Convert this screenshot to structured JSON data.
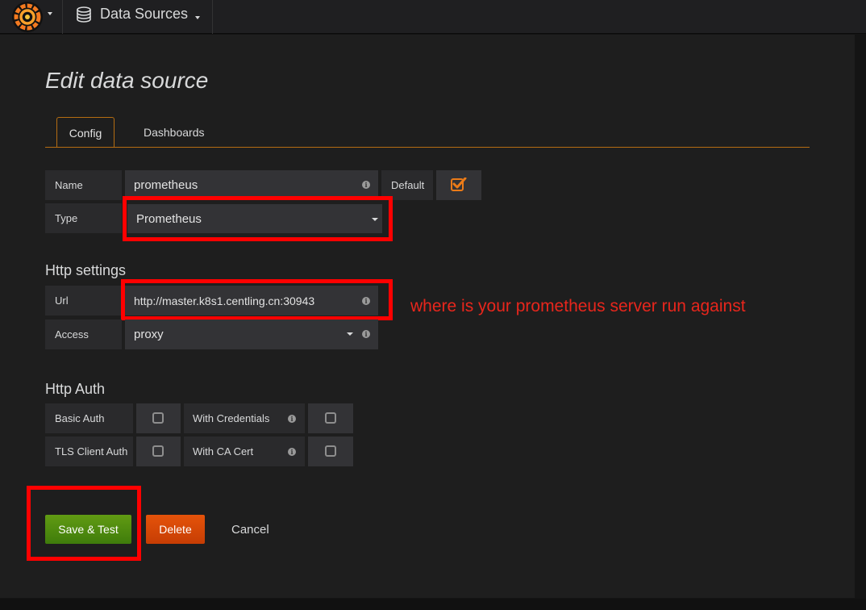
{
  "nav": {
    "breadcrumb_label": "Data Sources",
    "logo_icon": "grafana-logo-icon",
    "breadcrumb_icon": "database-icon"
  },
  "page": {
    "title": "Edit data source"
  },
  "tabs": [
    {
      "label": "Config",
      "active": true
    },
    {
      "label": "Dashboards",
      "active": false
    }
  ],
  "form": {
    "name_label": "Name",
    "name_value": "prometheus",
    "default_label": "Default",
    "default_checked": true,
    "type_label": "Type",
    "type_value": "Prometheus"
  },
  "http_settings": {
    "title": "Http settings",
    "url_label": "Url",
    "url_value": "http://master.k8s1.centling.cn:30943",
    "access_label": "Access",
    "access_value": "proxy"
  },
  "http_auth": {
    "title": "Http Auth",
    "basic_auth_label": "Basic Auth",
    "basic_auth_checked": false,
    "with_credentials_label": "With Credentials",
    "with_credentials_checked": false,
    "tls_client_auth_label": "TLS Client Auth",
    "tls_client_auth_checked": false,
    "with_ca_cert_label": "With CA Cert",
    "with_ca_cert_checked": false
  },
  "annotation": {
    "note": "where is your prometheus server run against",
    "color": "#e8261c"
  },
  "buttons": {
    "save": "Save & Test",
    "delete": "Delete",
    "cancel": "Cancel"
  },
  "colors": {
    "accent": "#b56d12",
    "save_green": "#4f8c0f",
    "delete_orange": "#d64808",
    "checkbox_orange": "#eb7b18"
  }
}
